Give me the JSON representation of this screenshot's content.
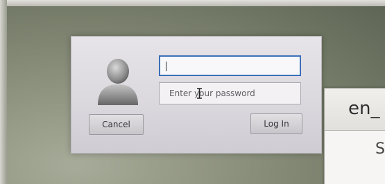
{
  "login_dialog": {
    "username": {
      "value": ""
    },
    "password": {
      "placeholder": "Enter your password"
    },
    "cancel_label": "Cancel",
    "login_label": "Log In",
    "avatar_icon": "user-avatar-icon"
  },
  "locale_panel": {
    "title": "en_",
    "sub_label": "S"
  },
  "colors": {
    "focus_border": "#3b6fb8",
    "dialog_bg": "#dedbe1"
  }
}
